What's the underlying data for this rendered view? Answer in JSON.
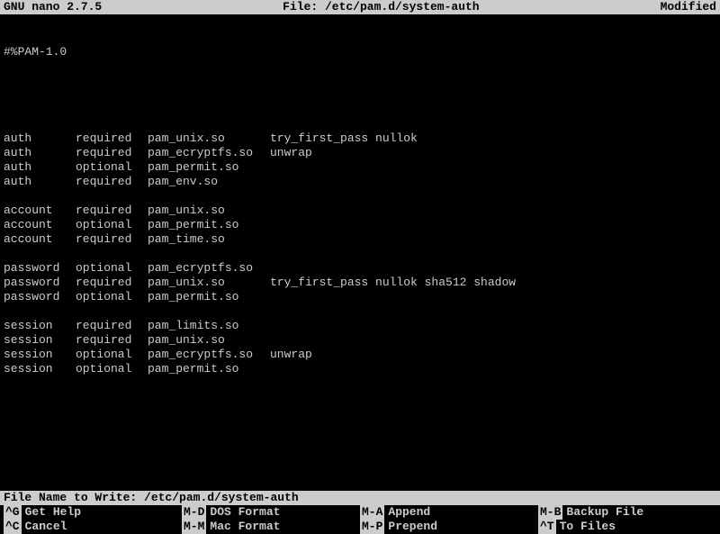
{
  "header": {
    "app": "GNU nano 2.7.5",
    "file_label": "File: /etc/pam.d/system-auth",
    "status": "Modified"
  },
  "file": {
    "first_line": "#%PAM-1.0",
    "rules": [
      {
        "type": "auth",
        "control": "required",
        "module": "pam_unix.so",
        "args": "try_first_pass nullok"
      },
      {
        "type": "auth",
        "control": "required",
        "module": "pam_ecryptfs.so",
        "args": "unwrap"
      },
      {
        "type": "auth",
        "control": "optional",
        "module": "pam_permit.so",
        "args": ""
      },
      {
        "type": "auth",
        "control": "required",
        "module": "pam_env.so",
        "args": ""
      },
      null,
      {
        "type": "account",
        "control": "required",
        "module": "pam_unix.so",
        "args": ""
      },
      {
        "type": "account",
        "control": "optional",
        "module": "pam_permit.so",
        "args": ""
      },
      {
        "type": "account",
        "control": "required",
        "module": "pam_time.so",
        "args": ""
      },
      null,
      {
        "type": "password",
        "control": "optional",
        "module": "pam_ecryptfs.so",
        "args": ""
      },
      {
        "type": "password",
        "control": "required",
        "module": "pam_unix.so",
        "args": "try_first_pass nullok sha512 shadow"
      },
      {
        "type": "password",
        "control": "optional",
        "module": "pam_permit.so",
        "args": ""
      },
      null,
      {
        "type": "session",
        "control": "required",
        "module": "pam_limits.so",
        "args": ""
      },
      {
        "type": "session",
        "control": "required",
        "module": "pam_unix.so",
        "args": ""
      },
      {
        "type": "session",
        "control": "optional",
        "module": "pam_ecryptfs.so",
        "args": "unwrap"
      },
      {
        "type": "session",
        "control": "optional",
        "module": "pam_permit.so",
        "args": ""
      }
    ]
  },
  "prompt": {
    "label": "File Name to Write: ",
    "value": "/etc/pam.d/system-auth"
  },
  "shortcuts": [
    {
      "key": "^G",
      "label": "Get Help"
    },
    {
      "key": "M-D",
      "label": "DOS Format"
    },
    {
      "key": "M-A",
      "label": "Append"
    },
    {
      "key": "M-B",
      "label": "Backup File"
    },
    {
      "key": "^C",
      "label": "Cancel"
    },
    {
      "key": "M-M",
      "label": "Mac Format"
    },
    {
      "key": "M-P",
      "label": "Prepend"
    },
    {
      "key": "^T",
      "label": "To Files"
    }
  ]
}
